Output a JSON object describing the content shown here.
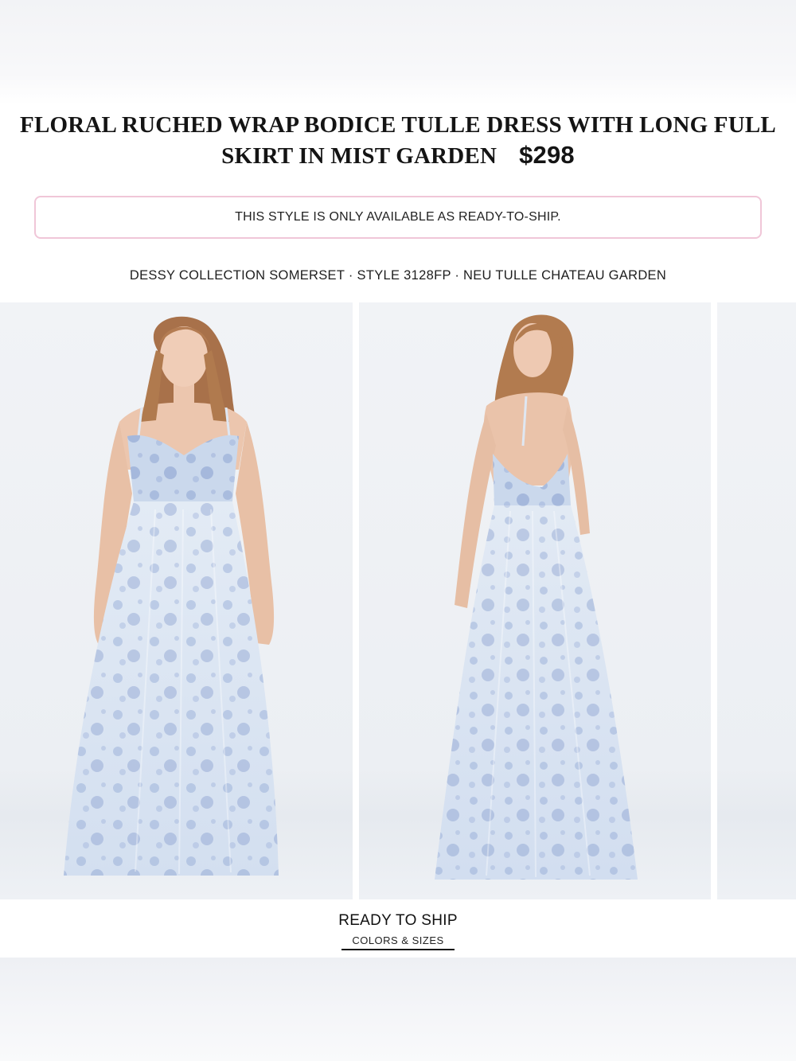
{
  "product": {
    "title": "FLORAL RUCHED WRAP BODICE TULLE DRESS WITH LONG FULL SKIRT IN MIST GARDEN",
    "price": "$298"
  },
  "notice": {
    "text": "THIS STYLE IS ONLY AVAILABLE AS READY-TO-SHIP.",
    "border_color": "#f0c6d8"
  },
  "style_line": "DESSY COLLECTION SOMERSET · STYLE 3128FP · NEU TULLE CHATEAU GARDEN",
  "gallery": {
    "images": [
      {
        "view": "front"
      },
      {
        "view": "back"
      },
      {
        "view": "partial"
      }
    ]
  },
  "tab": {
    "title": "READY TO SHIP",
    "subtitle": "COLORS & SIZES"
  },
  "colors": {
    "dress_base": "#dfe8f3",
    "floral_print": "#7d96c9",
    "hair": "#b07a4e",
    "skin": "#edc7b0",
    "background": "#eef1f5"
  }
}
